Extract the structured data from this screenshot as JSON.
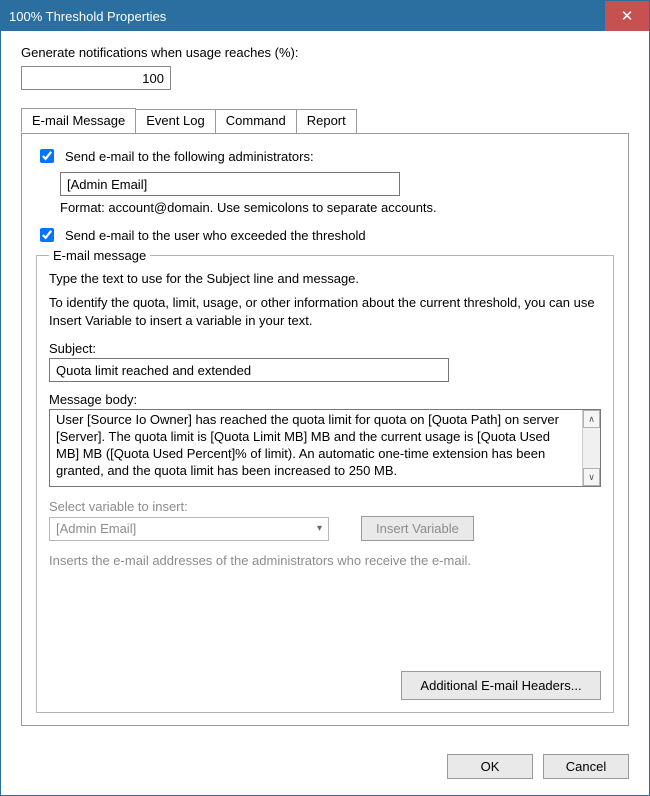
{
  "window": {
    "title": "100% Threshold Properties"
  },
  "generate": {
    "label": "Generate notifications when usage reaches (%):",
    "value": "100"
  },
  "tabs": {
    "email": "E-mail Message",
    "eventlog": "Event Log",
    "command": "Command",
    "report": "Report"
  },
  "email": {
    "send_admins_label": "Send e-mail to the following administrators:",
    "admins_value": "[Admin Email]",
    "format_hint": "Format: account@domain. Use semicolons to separate accounts.",
    "send_user_label": "Send e-mail to the user who exceeded the threshold",
    "fieldset_legend": "E-mail message",
    "instr1": "Type the text to use for the Subject line and message.",
    "instr2": "To identify the quota, limit, usage, or other information about the current threshold, you can use Insert Variable to insert a variable in your text.",
    "subject_label": "Subject:",
    "subject_value": "Quota limit reached and extended",
    "body_label": "Message body:",
    "body_value": "User [Source Io Owner] has reached the quota limit for quota on [Quota Path] on server [Server]. The quota limit is [Quota Limit MB] MB and the current usage is [Quota Used MB] MB ([Quota Used Percent]% of limit). An automatic one-time extension has been granted, and the quota limit has been increased to 250 MB.",
    "var_label": "Select variable to insert:",
    "var_selected": "[Admin Email]",
    "insert_var_btn": "Insert Variable",
    "var_help": "Inserts the e-mail addresses of the administrators who receive the e-mail.",
    "addl_headers_btn": "Additional E-mail Headers..."
  },
  "footer": {
    "ok": "OK",
    "cancel": "Cancel"
  }
}
